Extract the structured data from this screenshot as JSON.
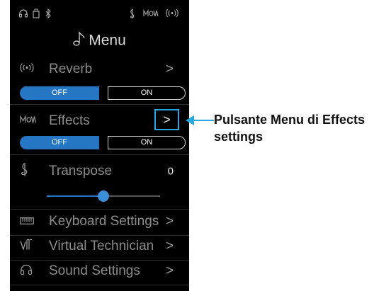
{
  "menu": {
    "title": "Menu"
  },
  "rows": {
    "reverb": {
      "label": "Reverb",
      "chevron": ">",
      "toggle_off": "OFF",
      "toggle_on": "ON"
    },
    "effects": {
      "label": "Effects",
      "chevron": ">",
      "toggle_off": "OFF",
      "toggle_on": "ON"
    },
    "transpose": {
      "label": "Transpose",
      "value": "0",
      "slider_level_fraction": 0.5
    },
    "keyboard_settings": {
      "label": "Keyboard Settings",
      "chevron": ">"
    },
    "virtual_technician": {
      "label": "Virtual Technician",
      "chevron": ">"
    },
    "sound_settings": {
      "label": "Sound Settings",
      "chevron": ">"
    }
  },
  "callout": {
    "text": "Pulsante Menu di Effects settings"
  },
  "colors": {
    "accent_blue": "#2577c4",
    "highlight_cyan": "#2aa8e0",
    "panel_bg": "#000000"
  }
}
